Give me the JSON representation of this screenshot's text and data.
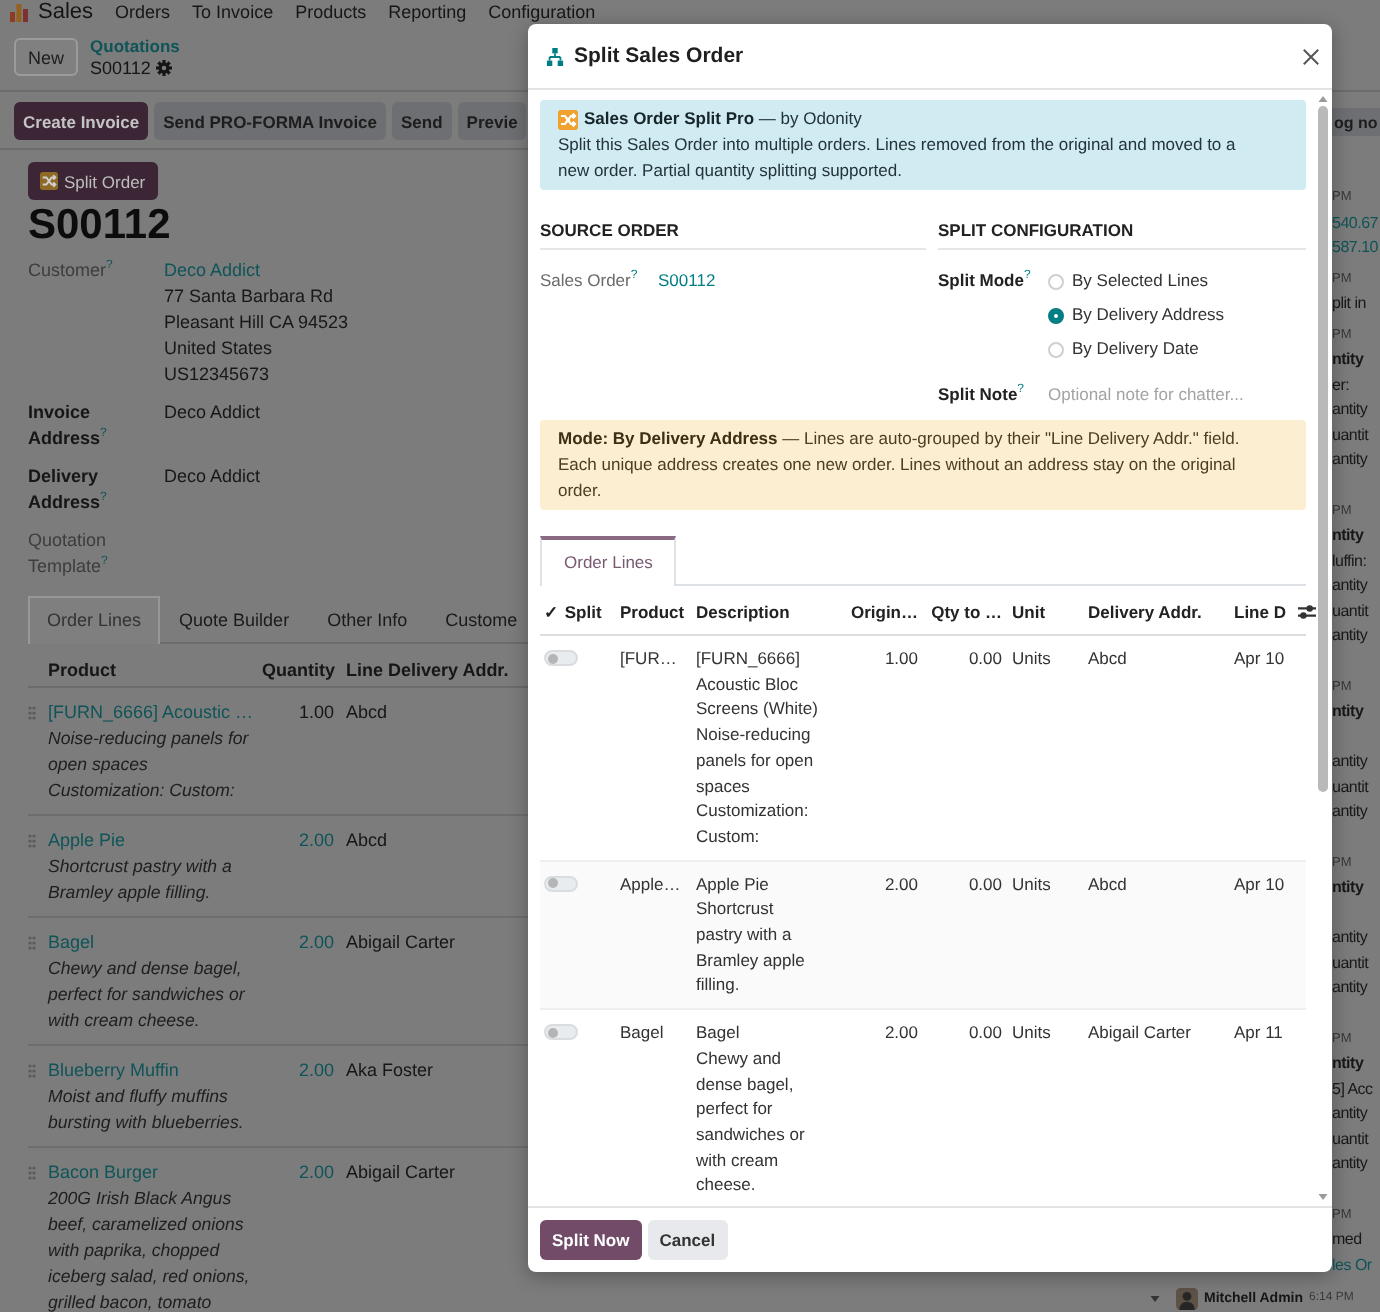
{
  "navbar": {
    "app": "Sales",
    "menus": [
      "Orders",
      "To Invoice",
      "Products",
      "Reporting",
      "Configuration"
    ]
  },
  "control_panel": {
    "new_button": "New",
    "breadcrumb": "Quotations",
    "record": "S00112"
  },
  "action_buttons": [
    {
      "label": "Create Invoice",
      "primary": true
    },
    {
      "label": "Send PRO-FORMA Invoice",
      "primary": false
    },
    {
      "label": "Send",
      "primary": false
    },
    {
      "label": "Previe",
      "primary": false
    }
  ],
  "form": {
    "split_button": "Split Order",
    "name": "S00112",
    "fields": [
      {
        "label": "Customer$^{?}$",
        "muted": true,
        "value": "Deco Addict",
        "link": true,
        "extra_lines": [
          "77 Santa Barbara Rd",
          "Pleasant Hill CA 94523",
          "United States",
          "US12345673"
        ]
      },
      {
        "label": "Invoice Address$^{?}$",
        "muted": false,
        "value": "Deco Addict",
        "link": false
      },
      {
        "label": "Delivery Address$^{?}$",
        "muted": false,
        "value": "Deco Addict",
        "link": false
      },
      {
        "label": "Quotation Template$^{?}$",
        "muted": true
      }
    ],
    "tabs": [
      {
        "label": "Order Lines",
        "selected": true
      },
      {
        "label": "Quote Builder",
        "selected": false
      },
      {
        "label": "Other Info",
        "selected": false
      },
      {
        "label": "Custome",
        "selected": false
      }
    ],
    "order_lines": {
      "columns": [
        "Product",
        "Quantity",
        "Line Delivery Addr."
      ],
      "rows": [
        {
          "product": "[FURN_6666] Acoustic …",
          "description": "Noise-reducing panels for open spaces\nCustomization: Custom:",
          "quantity": "1.00",
          "quantity_link": false,
          "delivery_addr": "Abcd"
        },
        {
          "product": "Apple Pie",
          "description": "Shortcrust pastry with a Bramley apple filling.",
          "quantity": "2.00",
          "quantity_link": true,
          "delivery_addr": "Abcd"
        },
        {
          "product": "Bagel",
          "description": "Chewy and dense bagel, perfect for sandwiches or with cream cheese.",
          "quantity": "2.00",
          "quantity_link": true,
          "delivery_addr": "Abigail Carter"
        },
        {
          "product": "Blueberry Muffin",
          "description": "Moist and fluffy muffins bursting with blueberries.",
          "quantity": "2.00",
          "quantity_link": true,
          "delivery_addr": "Aka Foster"
        },
        {
          "product": "Bacon Burger",
          "description": "200G Irish Black Angus beef, caramelized onions with paprika, chopped iceberg salad, red onions, grilled bacon, tomato",
          "quantity": "2.00",
          "quantity_link": true,
          "delivery_addr": "Abigail Carter"
        }
      ]
    }
  },
  "chatter": {
    "log_note_button": "og no",
    "entries": [
      {
        "time": "PM",
        "lines": [
          {
            "text": "540.67",
            "kind": "link"
          },
          {
            "text": "587.10",
            "kind": "link"
          }
        ]
      },
      {
        "time": "PM",
        "lines": [
          {
            "text": "plit in",
            "kind": "text"
          }
        ]
      },
      {
        "time": "PM",
        "lines": [
          {
            "text": "ntity",
            "kind": "bold"
          },
          {
            "text": "er:",
            "kind": "text"
          },
          {
            "text": "antity",
            "kind": "text"
          },
          {
            "text": "uantit",
            "kind": "text"
          },
          {
            "text": "antity",
            "kind": "text"
          }
        ]
      },
      {
        "time": "PM",
        "lines": [
          {
            "text": "ntity",
            "kind": "bold"
          },
          {
            "text": "luffin:",
            "kind": "text"
          },
          {
            "text": "antity",
            "kind": "text"
          },
          {
            "text": "uantit",
            "kind": "text"
          },
          {
            "text": "antity",
            "kind": "text"
          }
        ]
      },
      {
        "time": "PM",
        "lines": [
          {
            "text": "ntity",
            "kind": "bold"
          },
          {
            "text": "antity",
            "kind": "text"
          },
          {
            "text": "uantit",
            "kind": "text"
          },
          {
            "text": "antity",
            "kind": "text"
          }
        ]
      },
      {
        "time": "PM",
        "lines": [
          {
            "text": "ntity",
            "kind": "bold"
          },
          {
            "text": "antity",
            "kind": "text"
          },
          {
            "text": "uantit",
            "kind": "text"
          },
          {
            "text": "antity",
            "kind": "text"
          }
        ]
      },
      {
        "time": "PM",
        "lines": [
          {
            "text": "ntity",
            "kind": "bold"
          },
          {
            "text": "5] Acc",
            "kind": "text"
          },
          {
            "text": "antity",
            "kind": "text"
          },
          {
            "text": "uantit",
            "kind": "text"
          },
          {
            "text": "antity",
            "kind": "text"
          }
        ]
      },
      {
        "time": "PM",
        "lines": [
          {
            "text": "med",
            "kind": "text"
          },
          {
            "text": "les Or",
            "kind": "link"
          }
        ]
      }
    ],
    "author": {
      "name": "Mitchell Admin",
      "time": "6:14 PM"
    }
  },
  "dialog": {
    "title": "Split Sales Order",
    "banner": {
      "heading": "**Sales Order Split Pro** — by Odonity",
      "text": "Split this Sales Order into multiple orders. Lines removed from the original and moved to a new order. Partial quantity splitting supported."
    },
    "source": {
      "heading": "SOURCE ORDER",
      "label": "Sales Order$^{?}$",
      "value": "S00112"
    },
    "config": {
      "heading": "SPLIT CONFIGURATION",
      "mode_label": "Split Mode$^{?}$",
      "modes": [
        {
          "label": "By Selected Lines",
          "selected": false
        },
        {
          "label": "By Delivery Address",
          "selected": true
        },
        {
          "label": "By Delivery Date",
          "selected": false
        }
      ],
      "note_label": "Split Note$^{?}$",
      "note_placeholder": "Optional note for chatter..."
    },
    "notice": "**Mode: By Delivery Address** — Lines are auto-grouped by their \"Line Delivery Addr.\" field. Each unique address creates one new order. Lines without an address stay on the original order.",
    "tabs": [
      {
        "label": "Order Lines",
        "selected": true
      }
    ],
    "table": {
      "columns": [
        "✓ Split",
        "Product",
        "Description",
        "Origin…",
        "Qty to …",
        "Unit",
        "Delivery Addr.",
        "Line D"
      ],
      "rows": [
        {
          "split": false,
          "product": "[FUR…",
          "description": "[FURN_6666] Acoustic Bloc Screens (White)\nNoise-reducing panels for open spaces\nCustomization: Custom:",
          "original_qty": "1.00",
          "qty_to_split": "0.00",
          "unit": "Units",
          "delivery_addr": "Abcd",
          "line_date": "Apr 10"
        },
        {
          "split": false,
          "product": "Apple…",
          "description": "Apple Pie\nShortcrust pastry with a Bramley apple filling.",
          "original_qty": "2.00",
          "qty_to_split": "0.00",
          "unit": "Units",
          "delivery_addr": "Abcd",
          "line_date": "Apr 10"
        },
        {
          "split": false,
          "product": "Bagel",
          "description": "Bagel\nChewy and dense bagel, perfect for sandwiches or with cream cheese.",
          "original_qty": "2.00",
          "qty_to_split": "0.00",
          "unit": "Units",
          "delivery_addr": "Abigail Carter",
          "line_date": "Apr 11"
        }
      ]
    },
    "buttons": [
      {
        "label": "Split Now",
        "primary": true
      },
      {
        "label": "Cancel",
        "primary": false
      }
    ]
  }
}
